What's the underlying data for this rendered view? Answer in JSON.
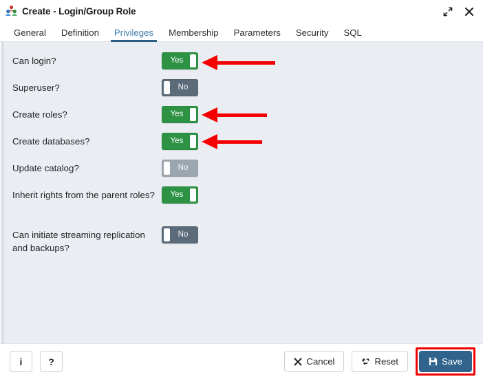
{
  "window": {
    "title": "Create - Login/Group Role",
    "app_icon": "roles-group-icon",
    "controls": {
      "maximize": "maximize-icon",
      "close": "close-icon"
    }
  },
  "tabs": [
    {
      "label": "General",
      "active": false
    },
    {
      "label": "Definition",
      "active": false
    },
    {
      "label": "Privileges",
      "active": true
    },
    {
      "label": "Membership",
      "active": false
    },
    {
      "label": "Parameters",
      "active": false
    },
    {
      "label": "Security",
      "active": false
    },
    {
      "label": "SQL",
      "active": false
    }
  ],
  "privileges": [
    {
      "label": "Can login?",
      "value": "Yes",
      "state": "yes",
      "annotated": true,
      "arrow_length": 107
    },
    {
      "label": "Superuser?",
      "value": "No",
      "state": "no",
      "annotated": false,
      "arrow_length": 0
    },
    {
      "label": "Create roles?",
      "value": "Yes",
      "state": "yes",
      "annotated": true,
      "arrow_length": 95
    },
    {
      "label": "Create databases?",
      "value": "Yes",
      "state": "yes",
      "annotated": true,
      "arrow_length": 88
    },
    {
      "label": "Update catalog?",
      "value": "No",
      "state": "no-disabled",
      "annotated": false,
      "arrow_length": 0
    },
    {
      "label": "Inherit rights from the parent roles?",
      "value": "Yes",
      "state": "yes",
      "annotated": false,
      "arrow_length": 0
    },
    {
      "label": "Can initiate streaming replication and backups?",
      "value": "No",
      "state": "no",
      "annotated": false,
      "arrow_length": 0
    }
  ],
  "footer": {
    "info_label": "i",
    "help_label": "?",
    "cancel_label": "Cancel",
    "reset_label": "Reset",
    "save_label": "Save"
  },
  "colors": {
    "toggle_yes": "#2e9245",
    "toggle_no": "#5c6b7a",
    "toggle_no_disabled": "#9ba6ae",
    "tab_active": "#3d7ba8",
    "tab_underline": "#2c5f86",
    "save_button": "#31648c",
    "annotation_red": "#f50000",
    "content_bg": "#eaedf2"
  }
}
